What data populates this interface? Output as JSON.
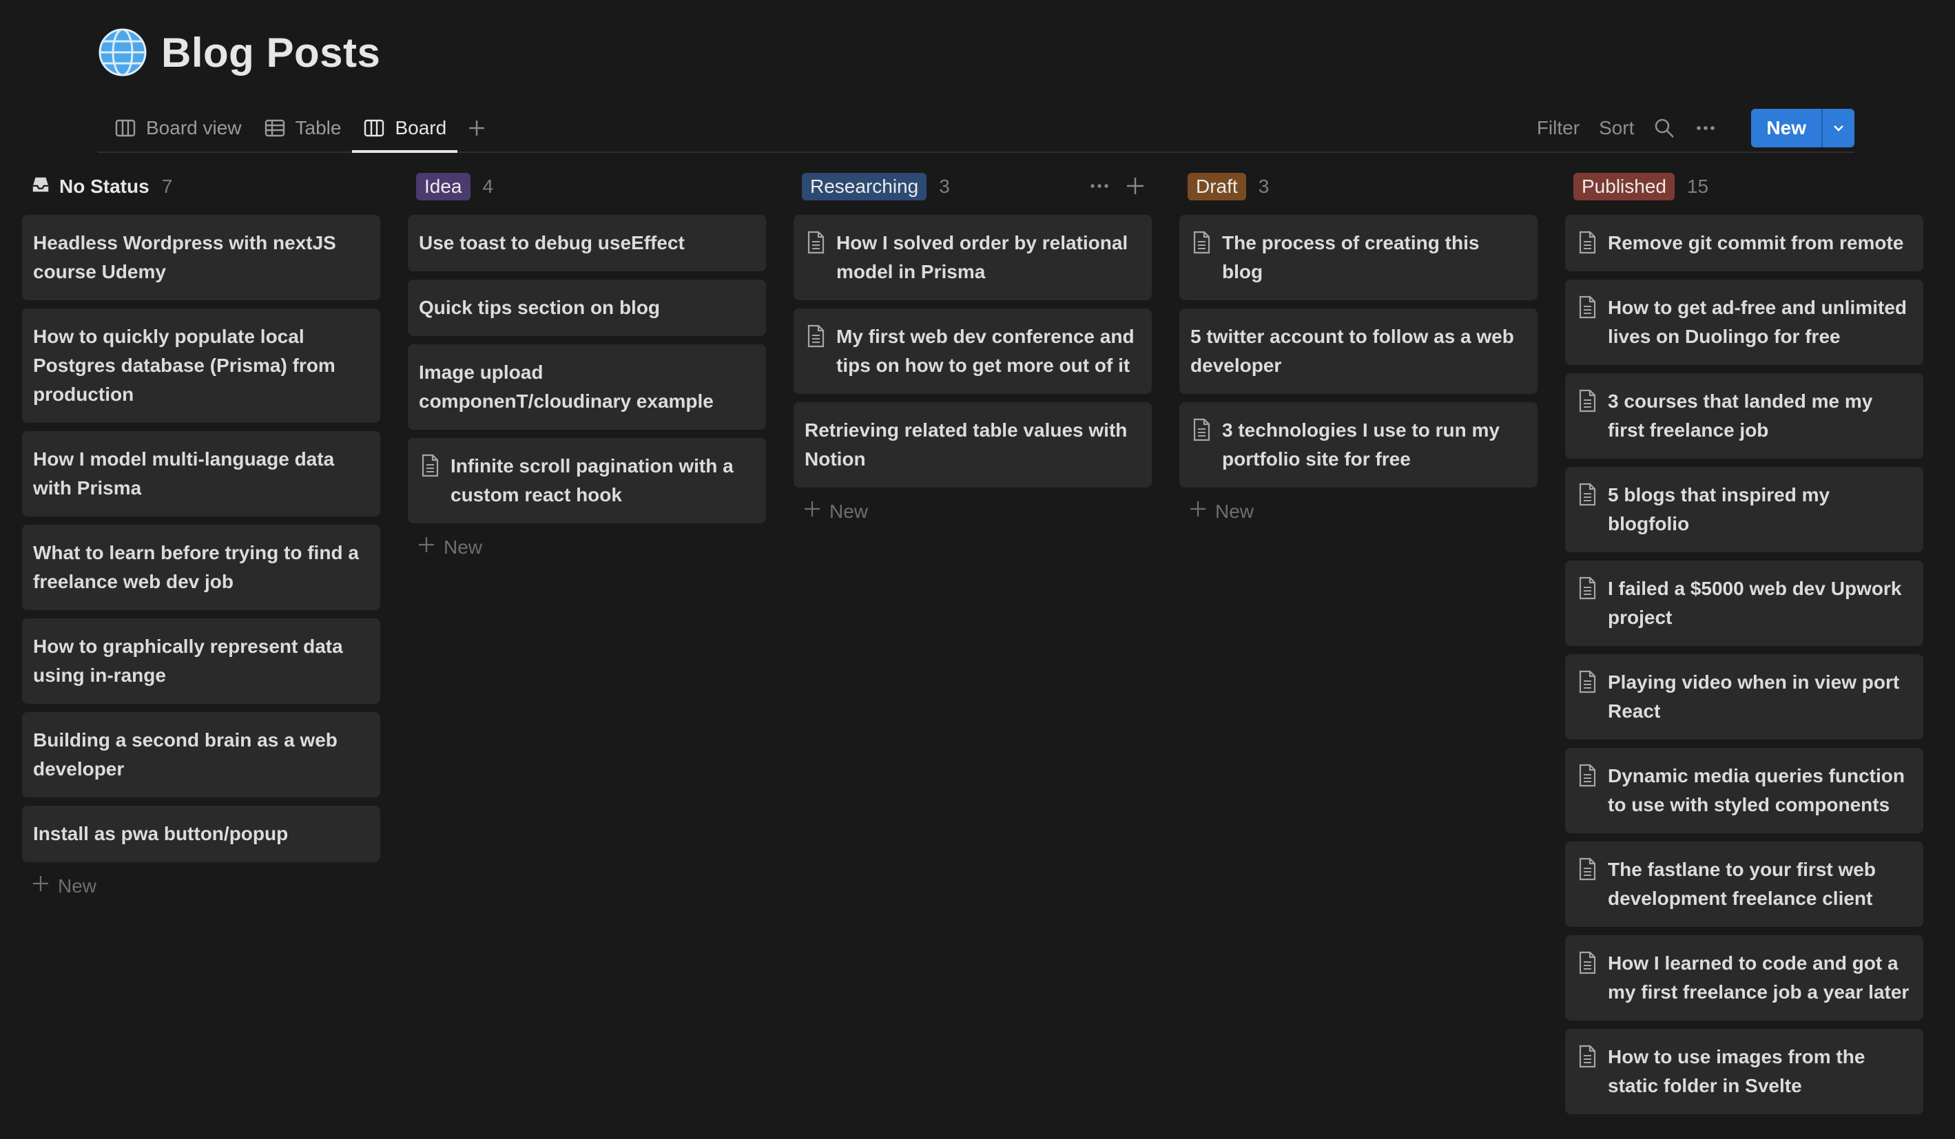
{
  "page": {
    "title": "Blog Posts",
    "icon": "globe-icon"
  },
  "views": [
    {
      "label": "Board view",
      "icon": "board-icon",
      "active": false
    },
    {
      "label": "Table",
      "icon": "table-icon",
      "active": false
    },
    {
      "label": "Board",
      "icon": "board-icon",
      "active": true
    }
  ],
  "toolbar": {
    "filter": "Filter",
    "sort": "Sort",
    "new": "New"
  },
  "board": {
    "new_label": "New",
    "columns": [
      {
        "name": "No Status",
        "count": "7",
        "color": "",
        "cards": [
          {
            "title": "Headless Wordpress with nextJS course Udemy",
            "icon": false
          },
          {
            "title": "How to quickly populate local Postgres database (Prisma) from production",
            "icon": false
          },
          {
            "title": "How I model multi-language data with Prisma",
            "icon": false
          },
          {
            "title": "What to learn before trying to find a freelance web dev job",
            "icon": false
          },
          {
            "title": "How to graphically represent data using in-range",
            "icon": false
          },
          {
            "title": "Building a second brain as a web developer",
            "icon": false
          },
          {
            "title": "Install as pwa button/popup",
            "icon": false
          }
        ]
      },
      {
        "name": "Idea",
        "count": "4",
        "color": "#4b3a6e",
        "cards": [
          {
            "title": "Use toast to debug useEffect",
            "icon": false
          },
          {
            "title": "Quick tips section on blog",
            "icon": false
          },
          {
            "title": "Image upload componenT/cloudinary example",
            "icon": false
          },
          {
            "title": "Infinite scroll pagination with a custom react hook",
            "icon": true
          }
        ]
      },
      {
        "name": "Researching",
        "count": "3",
        "color": "#2d4a73",
        "cards": [
          {
            "title": "How I solved order by relational model in Prisma",
            "icon": true
          },
          {
            "title": "My first web dev conference and tips on how to get more out of it",
            "icon": true
          },
          {
            "title": "Retrieving related table values with Notion",
            "icon": false
          }
        ]
      },
      {
        "name": "Draft",
        "count": "3",
        "color": "#7a4b22",
        "cards": [
          {
            "title": "The process of creating this blog",
            "icon": true
          },
          {
            "title": "5 twitter account to follow as a web developer",
            "icon": false
          },
          {
            "title": "3 technologies I use to run my portfolio site for free",
            "icon": true
          }
        ]
      },
      {
        "name": "Published",
        "count": "15",
        "color": "#7b3a32",
        "cards": [
          {
            "title": "Remove git commit from remote",
            "icon": true
          },
          {
            "title": "How to get ad-free and unlimited lives on Duolingo for free",
            "icon": true
          },
          {
            "title": "3 courses that landed me my first freelance job",
            "icon": true
          },
          {
            "title": "5 blogs that inspired my blogfolio",
            "icon": true
          },
          {
            "title": "I failed a $5000 web dev Upwork project",
            "icon": true
          },
          {
            "title": "Playing video when in view port React",
            "icon": true
          },
          {
            "title": "Dynamic media queries function to use with styled components",
            "icon": true
          },
          {
            "title": "The fastlane to your first web development freelance client",
            "icon": true
          },
          {
            "title": "How I learned to code and got a my first freelance job a year later",
            "icon": true
          },
          {
            "title": "How to use images from the static folder in Svelte",
            "icon": true
          }
        ]
      }
    ]
  }
}
